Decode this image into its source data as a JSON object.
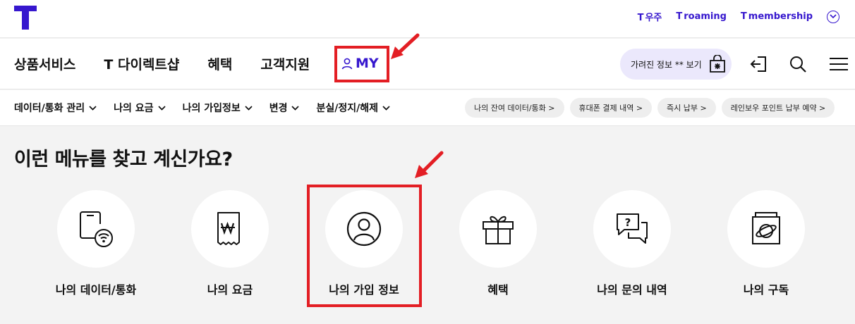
{
  "top_links": [
    {
      "mark": "T",
      "label": "우주"
    },
    {
      "mark": "T",
      "label": "roaming"
    },
    {
      "mark": "T",
      "label": "membership"
    }
  ],
  "main_nav": [
    "상품서비스",
    "T 다이렉트샵",
    "혜택",
    "고객지원"
  ],
  "my_label": "MY",
  "hidden_info_button": "가려진 정보 ** 보기",
  "sub_nav": [
    "데이터/통화 관리",
    "나의 요금",
    "나의 가입정보",
    "변경",
    "분실/정지/해제"
  ],
  "quick_chips": [
    "나의 잔여 데이터/통화 >",
    "휴대폰 결제 내역 >",
    "즉시 납부 >",
    "레인보우 포인트 납부 예약 >"
  ],
  "section_title": "이런 메뉴를 찾고 계신가요?",
  "menu_cards": [
    {
      "label": "나의 데이터/통화",
      "icon": "phone-wifi-icon"
    },
    {
      "label": "나의 요금",
      "icon": "bill-won-icon"
    },
    {
      "label": "나의 가입 정보",
      "icon": "user-circle-icon"
    },
    {
      "label": "혜택",
      "icon": "gift-icon"
    },
    {
      "label": "나의 문의 내역",
      "icon": "question-chat-icon"
    },
    {
      "label": "나의 구독",
      "icon": "subscribe-box-icon"
    }
  ],
  "colors": {
    "brand": "#3617ce",
    "highlight": "#e31e24"
  }
}
